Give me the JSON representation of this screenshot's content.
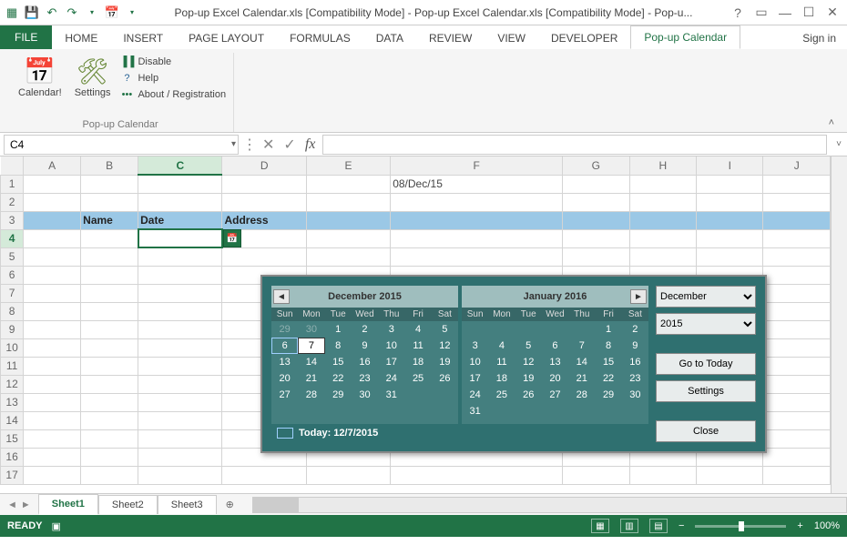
{
  "titlebar": {
    "title": "Pop-up Excel Calendar.xls  [Compatibility Mode] - Pop-up Excel Calendar.xls  [Compatibility Mode] - Pop-u..."
  },
  "tabs": {
    "file": "FILE",
    "list": [
      "HOME",
      "INSERT",
      "PAGE LAYOUT",
      "FORMULAS",
      "DATA",
      "REVIEW",
      "VIEW",
      "DEVELOPER"
    ],
    "active": "Pop-up Calendar",
    "signin": "Sign in"
  },
  "ribbon": {
    "calendar_btn": "Calendar!",
    "settings_btn": "Settings",
    "disable": "Disable",
    "help": "Help",
    "about": "About / Registration",
    "group_label": "Pop-up Calendar"
  },
  "namebox": "C4",
  "columns": [
    "A",
    "B",
    "C",
    "D",
    "E",
    "F",
    "G",
    "H",
    "I",
    "J"
  ],
  "rows": [
    1,
    2,
    3,
    4,
    5,
    6,
    7,
    8,
    9,
    10,
    11,
    12,
    13,
    14,
    15,
    16,
    17
  ],
  "active_row": 4,
  "active_col": "C",
  "cells": {
    "F1": "08/Dec/15",
    "B3": "Name",
    "C3": "Date",
    "D3": "Address"
  },
  "calendar": {
    "month1": {
      "title": "December 2015",
      "dow": [
        "Sun",
        "Mon",
        "Tue",
        "Wed",
        "Thu",
        "Fri",
        "Sat"
      ],
      "grid": [
        [
          "29",
          "30",
          "1",
          "2",
          "3",
          "4",
          "5"
        ],
        [
          "6",
          "7",
          "8",
          "9",
          "10",
          "11",
          "12"
        ],
        [
          "13",
          "14",
          "15",
          "16",
          "17",
          "18",
          "19"
        ],
        [
          "20",
          "21",
          "22",
          "23",
          "24",
          "25",
          "26"
        ],
        [
          "27",
          "28",
          "29",
          "30",
          "31",
          "",
          ""
        ]
      ],
      "dim": [
        [
          0,
          0
        ],
        [
          0,
          1
        ]
      ],
      "today": [
        1,
        0
      ],
      "selected": [
        1,
        1
      ]
    },
    "month2": {
      "title": "January 2016",
      "dow": [
        "Sun",
        "Mon",
        "Tue",
        "Wed",
        "Thu",
        "Fri",
        "Sat"
      ],
      "grid": [
        [
          "",
          "",
          "",
          "",
          "",
          "1",
          "2"
        ],
        [
          "3",
          "4",
          "5",
          "6",
          "7",
          "8",
          "9"
        ],
        [
          "10",
          "11",
          "12",
          "13",
          "14",
          "15",
          "16"
        ],
        [
          "17",
          "18",
          "19",
          "20",
          "21",
          "22",
          "23"
        ],
        [
          "24",
          "25",
          "26",
          "27",
          "28",
          "29",
          "30"
        ],
        [
          "31",
          "",
          "",
          "",
          "",
          "",
          ""
        ]
      ]
    },
    "today_label": "Today: 12/7/2015",
    "month_select": "December",
    "year_select": "2015",
    "goto": "Go to Today",
    "settings": "Settings",
    "close": "Close"
  },
  "sheet_tabs": [
    "Sheet1",
    "Sheet2",
    "Sheet3"
  ],
  "active_sheet": "Sheet1",
  "status": {
    "ready": "READY",
    "zoom": "100%"
  }
}
